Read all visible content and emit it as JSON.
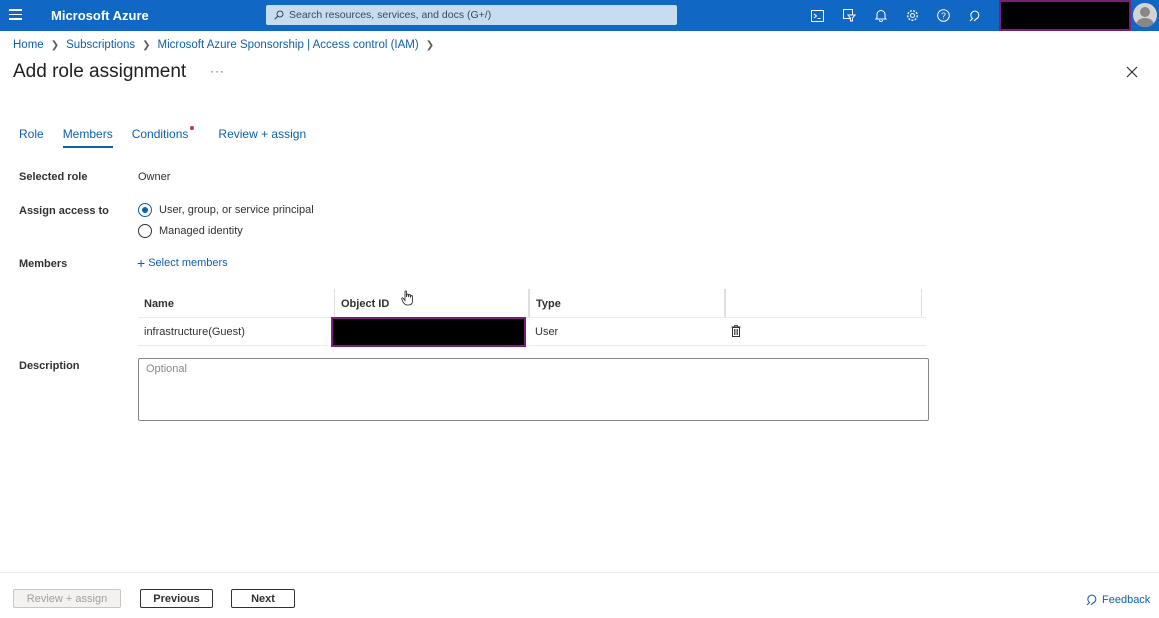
{
  "topbar": {
    "brand": "Microsoft Azure",
    "search_placeholder": "Search resources, services, and docs (G+/)",
    "icons": [
      "cloud-shell-icon",
      "directory-filter-icon",
      "bell-icon",
      "gear-icon",
      "help-icon",
      "feedback-icon"
    ]
  },
  "breadcrumb": {
    "items": [
      "Home",
      "Subscriptions",
      "Microsoft Azure Sponsorship | Access control (IAM)"
    ]
  },
  "page": {
    "title": "Add role assignment",
    "more": "···"
  },
  "tabs": [
    {
      "label": "Role"
    },
    {
      "label": "Members"
    },
    {
      "label": "Conditions"
    },
    {
      "label": "Review + assign"
    }
  ],
  "form": {
    "selected_role_label": "Selected role",
    "selected_role_value": "Owner",
    "assign_access_label": "Assign access to",
    "assign_options": [
      "User, group, or service principal",
      "Managed identity"
    ],
    "members_label": "Members",
    "select_members": "Select members",
    "description_label": "Description",
    "description_placeholder": "Optional"
  },
  "table": {
    "headers": [
      "Name",
      "Object ID",
      "Type"
    ],
    "rows": [
      {
        "name": "infrastructure(Guest)",
        "type": "User"
      }
    ]
  },
  "footer": {
    "review_assign": "Review + assign",
    "previous": "Previous",
    "next": "Next",
    "feedback": "Feedback"
  },
  "colors": {
    "topbar": "#1067c4",
    "link": "#0e5fb0",
    "redaction_border": "#7b1e7a"
  }
}
